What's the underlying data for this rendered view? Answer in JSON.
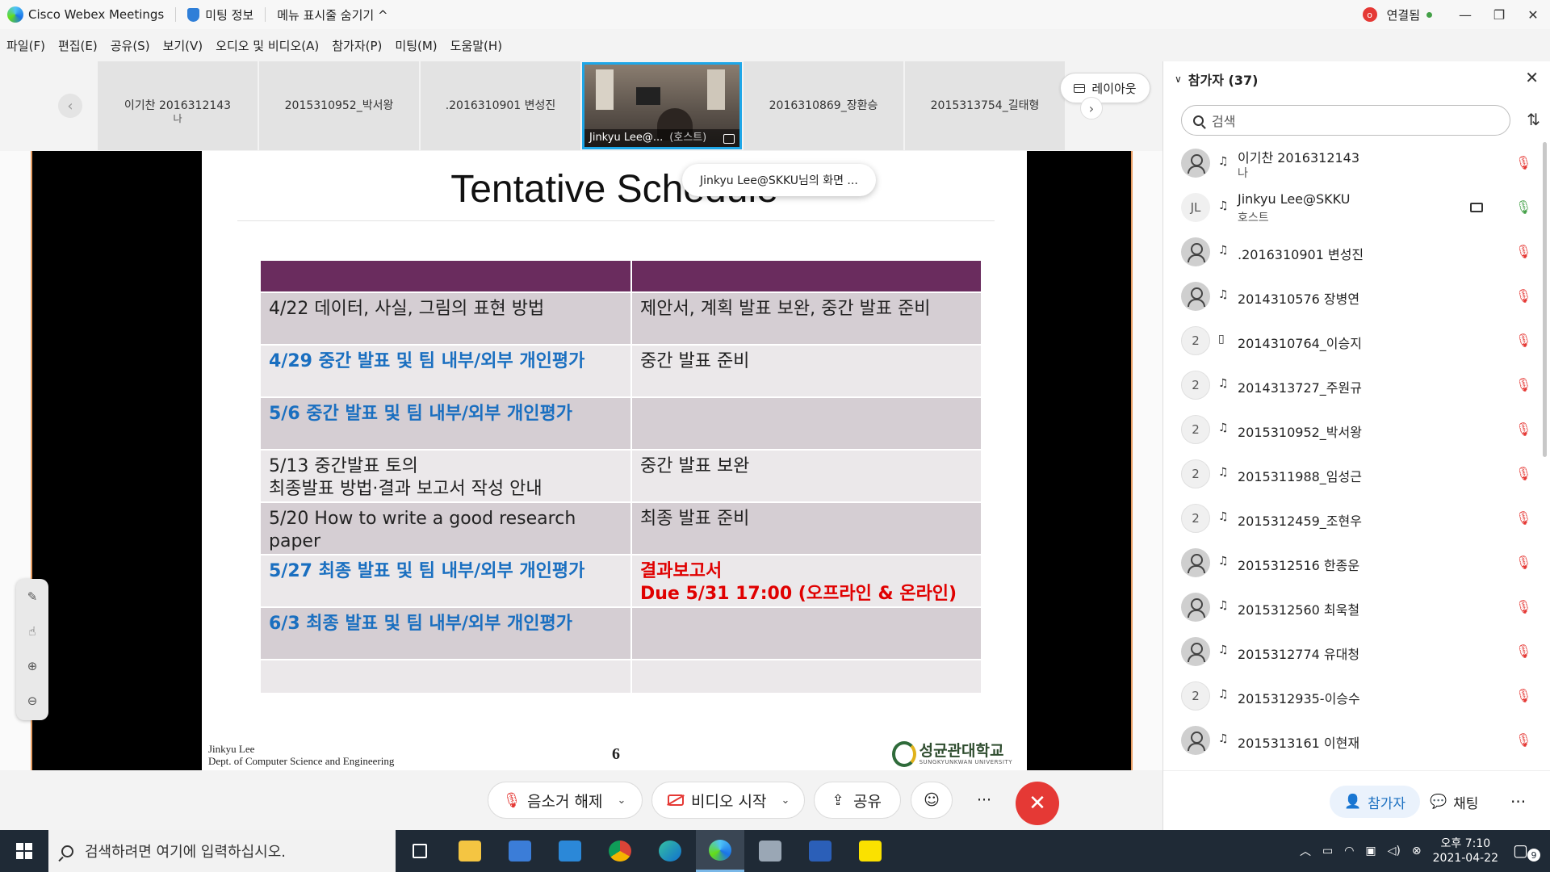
{
  "titlebar": {
    "app_name": "Cisco Webex Meetings",
    "meeting_info": "미팅 정보",
    "hide_menu": "메뉴 표시줄 숨기기 ^",
    "rec_badge": "o",
    "connection": "연결됨",
    "minimize": "—",
    "maximize": "❐",
    "close": "✕"
  },
  "menubar": [
    "파일(F)",
    "편집(E)",
    "공유(S)",
    "보기(V)",
    "오디오 및 비디오(A)",
    "참가자(P)",
    "미팅(M)",
    "도움말(H)"
  ],
  "thumbnails": {
    "prev": "‹",
    "next": "›",
    "items": [
      {
        "name": "이기찬 2016312143",
        "sub": "나"
      },
      {
        "name": "2015310952_박서왕",
        "sub": ""
      },
      {
        "name": ".2016310901 변성진",
        "sub": ""
      },
      {
        "name": "Jinkyu Lee@...",
        "sub": "(호스트)"
      },
      {
        "name": "2016310869_장환승",
        "sub": ""
      },
      {
        "name": "2015313754_길태형",
        "sub": ""
      }
    ],
    "layout_label": "레이아웃"
  },
  "share": {
    "sharer_popup": "Jinkyu Lee@SKKU님의 화면 ...",
    "slide": {
      "title": "Tentative Schedule",
      "rows": [
        {
          "c1": "4/22 데이터, 사실, 그림의 표현 방법",
          "c1_style": "",
          "c2": "제안서, 계획 발표 보완, 중간 발표 준비",
          "c2_style": ""
        },
        {
          "c1": "4/29 중간 발표 및 팀 내부/외부 개인평가",
          "c1_style": "blue",
          "c2": "중간 발표 준비",
          "c2_style": ""
        },
        {
          "c1": "5/6 중간 발표 및 팀 내부/외부 개인평가",
          "c1_style": "blue",
          "c2": "",
          "c2_style": ""
        },
        {
          "c1": "5/13 중간발표 토의",
          "c1b": "최종발표 방법·결과 보고서 작성 안내",
          "c1_style": "",
          "c2": "중간 발표 보완",
          "c2_style": ""
        },
        {
          "c1": "5/20 How to write a good research paper",
          "c1_style": "",
          "c2": "최종 발표 준비",
          "c2_style": ""
        },
        {
          "c1": "5/27 최종 발표 및 팀 내부/외부 개인평가",
          "c1_style": "blue",
          "c2": "결과보고서",
          "c2b": "Due 5/31 17:00 (오프라인 & 온라인)",
          "c2_style": "red"
        },
        {
          "c1": "6/3 최종 발표 및 팀 내부/외부 개인평가",
          "c1_style": "blue",
          "c2": "",
          "c2_style": ""
        }
      ],
      "footer_author": "Jinkyu Lee",
      "footer_dept": "Dept. of Computer Science and Engineering",
      "page_number": "6",
      "university_ko": "성균관대학교",
      "university_en": "SUNGKYUNKWAN UNIVERSITY"
    }
  },
  "controls": {
    "unmute": "음소거 해제",
    "start_video": "비디오 시작",
    "share": "공유",
    "reactions_icon": "☺",
    "more": "···",
    "end": "✕"
  },
  "panel": {
    "title": "참가자 (37)",
    "search_placeholder": "검색",
    "participants": [
      {
        "name": "이기찬 2016312143",
        "sub": "나",
        "avatar": "user",
        "avatar_text": "",
        "device": "headset",
        "video": false,
        "mic": "muted"
      },
      {
        "name": "Jinkyu Lee@SKKU",
        "sub": "호스트",
        "avatar": "initials",
        "avatar_text": "JL",
        "device": "headset",
        "video": true,
        "mic": "on"
      },
      {
        "name": ".2016310901 변성진",
        "sub": "",
        "avatar": "user",
        "avatar_text": "",
        "device": "headset",
        "video": false,
        "mic": "muted"
      },
      {
        "name": "2014310576 장병연",
        "sub": "",
        "avatar": "user",
        "avatar_text": "",
        "device": "headset",
        "video": false,
        "mic": "muted"
      },
      {
        "name": "2014310764_이승지",
        "sub": "",
        "avatar": "num",
        "avatar_text": "2",
        "device": "phone",
        "video": false,
        "mic": "muted"
      },
      {
        "name": "2014313727_주원규",
        "sub": "",
        "avatar": "num",
        "avatar_text": "2",
        "device": "headset",
        "video": false,
        "mic": "muted"
      },
      {
        "name": "2015310952_박서왕",
        "sub": "",
        "avatar": "num",
        "avatar_text": "2",
        "device": "headset",
        "video": false,
        "mic": "muted"
      },
      {
        "name": "2015311988_임성근",
        "sub": "",
        "avatar": "num",
        "avatar_text": "2",
        "device": "headset",
        "video": false,
        "mic": "muted"
      },
      {
        "name": "2015312459_조현우",
        "sub": "",
        "avatar": "num",
        "avatar_text": "2",
        "device": "headset",
        "video": false,
        "mic": "muted"
      },
      {
        "name": "2015312516 한종운",
        "sub": "",
        "avatar": "user",
        "avatar_text": "",
        "device": "headset",
        "video": false,
        "mic": "muted"
      },
      {
        "name": "2015312560 최욱철",
        "sub": "",
        "avatar": "user",
        "avatar_text": "",
        "device": "headset",
        "video": false,
        "mic": "muted"
      },
      {
        "name": "2015312774 유대청",
        "sub": "",
        "avatar": "user",
        "avatar_text": "",
        "device": "headset",
        "video": false,
        "mic": "muted"
      },
      {
        "name": "2015312935-이승수",
        "sub": "",
        "avatar": "num",
        "avatar_text": "2",
        "device": "headset",
        "video": false,
        "mic": "muted"
      },
      {
        "name": "2015313161 이현재",
        "sub": "",
        "avatar": "user",
        "avatar_text": "",
        "device": "headset",
        "video": false,
        "mic": "muted"
      }
    ],
    "footer": {
      "participants": "참가자",
      "chat": "채팅",
      "more": "···"
    }
  },
  "taskbar": {
    "search_placeholder": "검색하려면 여기에 입력하십시오.",
    "time": "오후 7:10",
    "date": "2021-04-22",
    "notifications": "9"
  }
}
